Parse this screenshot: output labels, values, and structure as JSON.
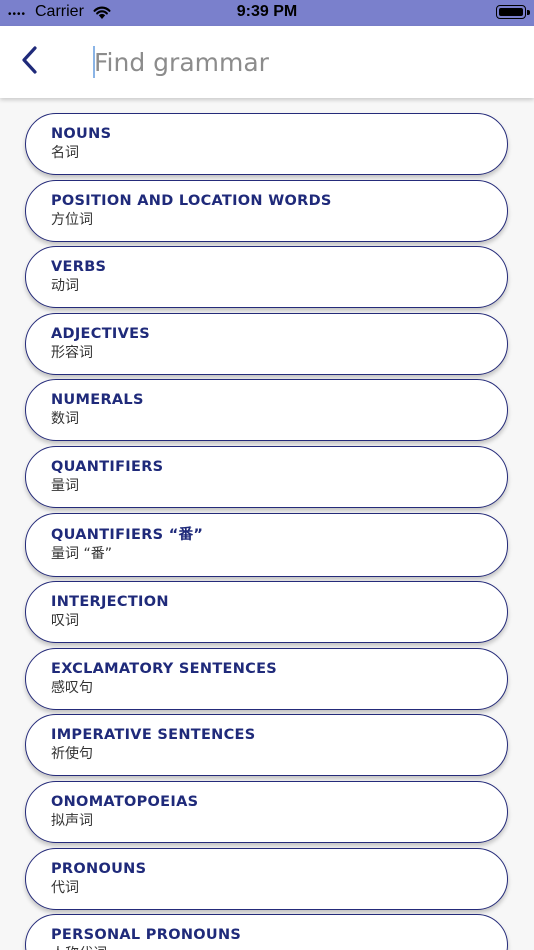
{
  "status_bar": {
    "signal": "••••",
    "carrier": "Carrier",
    "time": "9:39 PM"
  },
  "header": {
    "back_icon": "chevron-left-icon",
    "search_placeholder": "Find grammar",
    "search_value": ""
  },
  "colors": {
    "accent": "#1f2a7a",
    "status_bar_bg": "#7a80cc",
    "item_border": "#252b7a"
  },
  "items": [
    {
      "title": "NOUNS",
      "subtitle": "名词"
    },
    {
      "title": "POSITION AND LOCATION WORDS",
      "subtitle": "方位词"
    },
    {
      "title": "VERBS",
      "subtitle": "动词"
    },
    {
      "title": "ADJECTIVES",
      "subtitle": "形容词"
    },
    {
      "title": "NUMERALS",
      "subtitle": "数词"
    },
    {
      "title": "QUANTIFIERS",
      "subtitle": "量词"
    },
    {
      "title": "QUANTIFIERS “番”",
      "subtitle": "量词 “番”"
    },
    {
      "title": "INTERJECTION",
      "subtitle": "叹词"
    },
    {
      "title": "EXCLAMATORY SENTENCES",
      "subtitle": "感叹句"
    },
    {
      "title": "IMPERATIVE SENTENCES",
      "subtitle": "祈使句"
    },
    {
      "title": "ONOMATOPOEIAS",
      "subtitle": "拟声词"
    },
    {
      "title": "PRONOUNS",
      "subtitle": "代词"
    },
    {
      "title": "PERSONAL PRONOUNS",
      "subtitle": "人称代词"
    }
  ]
}
